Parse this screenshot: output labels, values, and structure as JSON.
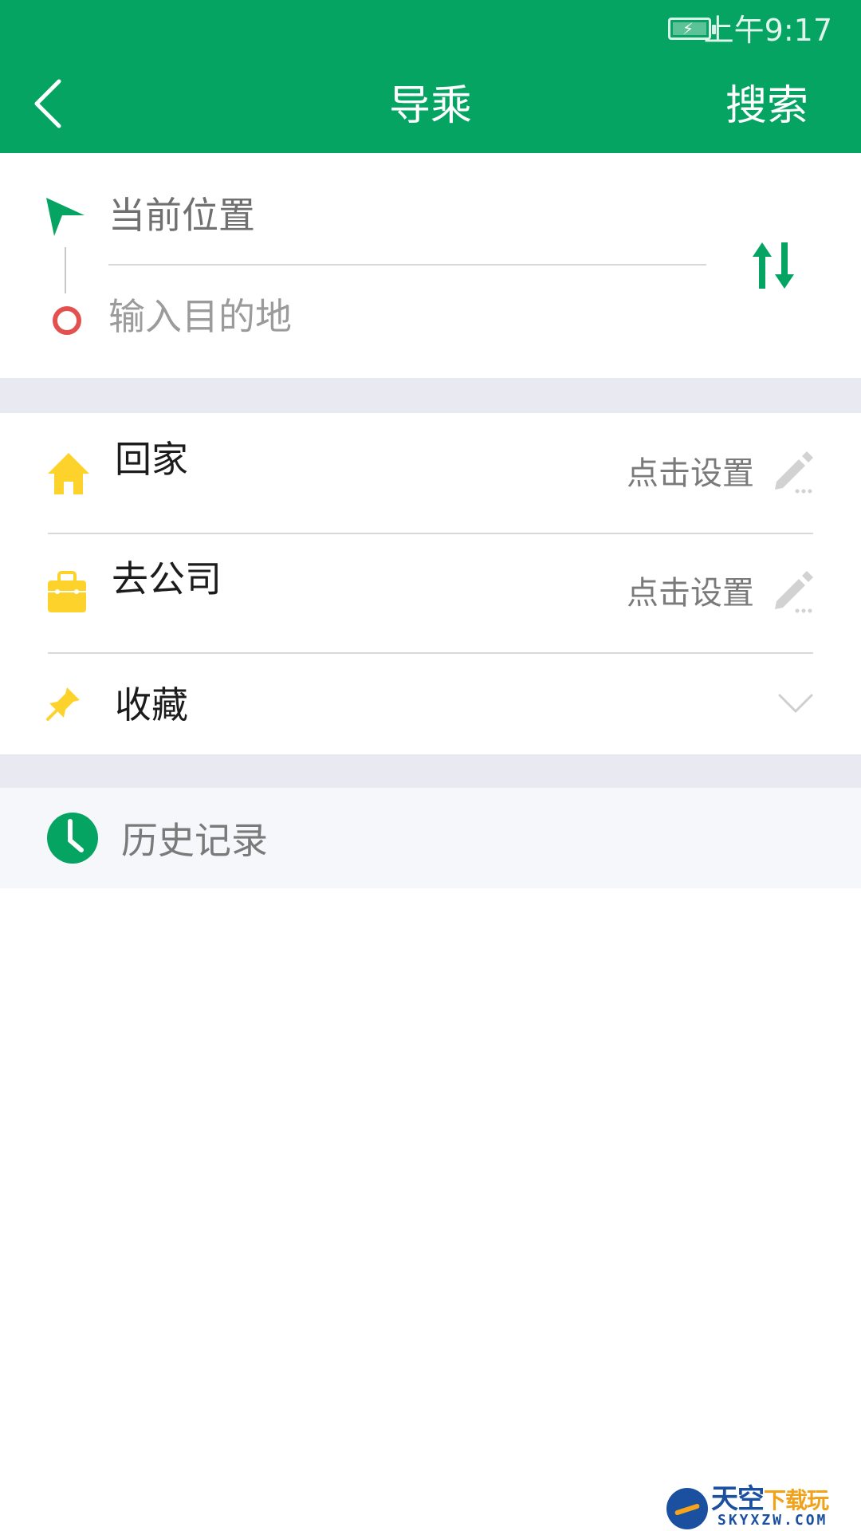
{
  "status_bar": {
    "time": "上午9:17",
    "battery_state": "charging"
  },
  "header": {
    "back_icon": "chevron-left-icon",
    "title": "导乘",
    "search_label": "搜索",
    "background_color": "#05a463"
  },
  "route": {
    "origin": "当前位置",
    "destination_placeholder": "输入目的地",
    "destination_value": "",
    "origin_icon": "navigation-arrow-icon",
    "destination_icon": "destination-dot-icon",
    "swap_icon": "swap-vertical-icon"
  },
  "places": [
    {
      "label": "回家",
      "action": "点击设置",
      "icon": "home-icon",
      "action_icon": "edit-pencil-icon"
    },
    {
      "label": "去公司",
      "action": "点击设置",
      "icon": "briefcase-icon",
      "action_icon": "edit-pencil-icon"
    },
    {
      "label": "收藏",
      "icon": "pin-icon",
      "action_icon": "chevron-down-icon"
    }
  ],
  "history": {
    "label": "历史记录",
    "icon": "clock-icon"
  },
  "watermark": {
    "title_main": "天空",
    "title_accent": "下载玩",
    "subtitle": "SKYXZW.COM"
  },
  "colors": {
    "accent": "#05a463",
    "icon_yellow": "#fdd32b",
    "destination_red": "#e2504f",
    "section_gap": "#e9e9f2"
  }
}
